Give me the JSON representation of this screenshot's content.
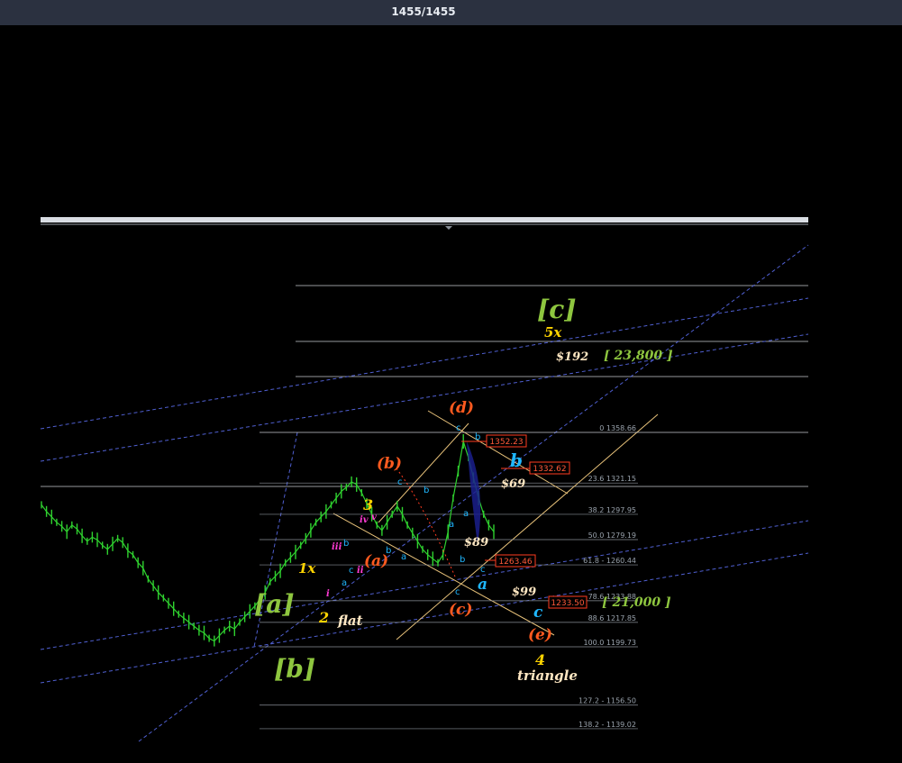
{
  "header": {
    "counter": "1455/1455"
  },
  "colors": {
    "background": "#000000",
    "price": "#2fd12f",
    "trendline": "#5a6bd6",
    "channel": "#e8c27a",
    "fib": "#c8ccd2",
    "cycle_label": "#8ec63f",
    "primary_label": "#ffd400",
    "intermediate_label": "#ff5a1f",
    "minor_label": "#1fb7ff",
    "target_label": "#ffe7c2",
    "price_box": "#ff3b1f"
  },
  "chart_data": {
    "type": "line",
    "series": [
      {
        "values": [
          1305,
          1300,
          1296,
          1292,
          1289,
          1285,
          1290,
          1287,
          1282,
          1278,
          1281,
          1279,
          1275,
          1272,
          1276,
          1280,
          1277,
          1271,
          1268,
          1262,
          1258,
          1250,
          1245,
          1240,
          1236,
          1232,
          1228,
          1224,
          1221,
          1218,
          1215,
          1212,
          1210,
          1206,
          1204,
          1208,
          1212,
          1215,
          1213,
          1218,
          1222,
          1226,
          1230,
          1235,
          1240,
          1248,
          1252,
          1256,
          1262,
          1266,
          1270,
          1275,
          1280,
          1286,
          1292,
          1296,
          1300,
          1305,
          1310,
          1315,
          1318,
          1322,
          1320,
          1314,
          1306,
          1298,
          1290,
          1286,
          1292,
          1298,
          1304,
          1298,
          1290,
          1284,
          1278,
          1272,
          1268,
          1265,
          1262,
          1268,
          1285,
          1310,
          1330,
          1352,
          1340,
          1325,
          1310,
          1298,
          1290,
          1285
        ]
      }
    ],
    "fibonacci_levels": [
      {
        "ratio": "0",
        "price": "1358.66",
        "label": "0 1358.66"
      },
      {
        "ratio": "23.6",
        "price": "1321.15",
        "label": "23.6 1321.15"
      },
      {
        "ratio": "38.2",
        "price": "1297.95",
        "label": "38.2 1297.95"
      },
      {
        "ratio": "50.0",
        "price": "1279.19",
        "label": "50.0 1279.19"
      },
      {
        "ratio": "61.8",
        "price": "1260.44",
        "label": "61.8 - 1260.44"
      },
      {
        "ratio": "78.6",
        "price": "1233.88",
        "label": "78.6 1233.88"
      },
      {
        "ratio": "88.6",
        "price": "1217.85",
        "label": "88.6 1217.85"
      },
      {
        "ratio": "100.0",
        "price": "1199.73",
        "label": "100.0 1199.73"
      },
      {
        "ratio": "127.2",
        "price": "1156.50",
        "label": "127.2 - 1156.50"
      },
      {
        "ratio": "138.2",
        "price": "1139.02",
        "label": "138.2 - 1139.02"
      }
    ],
    "price_boxes": [
      "1352.23",
      "1332.62",
      "1263.46",
      "1233.50"
    ],
    "wave_labels": {
      "cycle": [
        "[a]",
        "[b]",
        "[c]"
      ],
      "primary": [
        "1x",
        "2",
        "3",
        "4",
        "5x"
      ],
      "intermediate": [
        "(a)",
        "(b)",
        "(c)",
        "(d)",
        "(e)"
      ],
      "minor": [
        "a",
        "b",
        "c"
      ],
      "minute": [
        "i",
        "ii",
        "iii",
        "iv",
        "v"
      ],
      "small": [
        "a",
        "b",
        "c"
      ]
    },
    "annotations": {
      "flat": "flat",
      "triangle": "triangle",
      "target_1": "$192",
      "target_2": "[ 23,800 ]",
      "target_3": "$69",
      "target_4": "$89",
      "target_5": "$99",
      "target_6": "[ 21,000 ]"
    }
  }
}
